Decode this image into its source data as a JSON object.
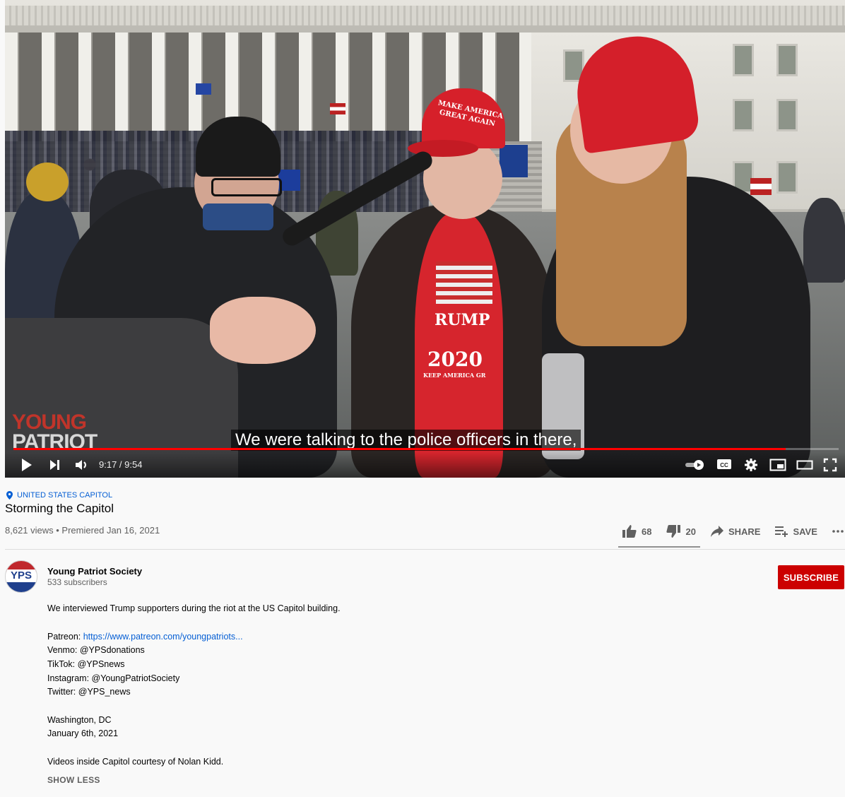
{
  "video": {
    "watermark_line1": "YOUNG",
    "watermark_line2": "PATRIOT",
    "caption": "We were talking to the police officers in there,",
    "time": "9:17 / 9:54",
    "progress": 0.936,
    "hat_text_1": "MAKE AMERICA",
    "hat_text_2": "GREAT AGAIN",
    "shirt_text_1": "RUMP",
    "shirt_text_2": "2020",
    "shirt_text_3": "KEEP AMERICA GR"
  },
  "controls": {
    "play_icon": "play-icon",
    "next_icon": "next-icon",
    "volume_icon": "volume-icon",
    "autoplay_icon": "autoplay-toggle-icon",
    "cc_label": "CC"
  },
  "meta": {
    "location": "UNITED STATES CAPITOL",
    "title": "Storming the Capitol",
    "stats": "8,621 views • Premiered Jan 16, 2021",
    "likes": "68",
    "dislikes": "20",
    "share": "SHARE",
    "save": "SAVE"
  },
  "channel": {
    "avatar_text": "YPS",
    "name": "Young Patriot Society",
    "subscribers": "533 subscribers",
    "subscribe_label": "SUBSCRIBE"
  },
  "description": {
    "line1": "We interviewed Trump supporters during the riot at the US Capitol building.",
    "patreon_label": "Patreon: ",
    "patreon_link": "https://www.patreon.com/youngpatriots...",
    "venmo": "Venmo: @YPSdonations",
    "tiktok": "TikTok: @YPSnews",
    "instagram": "Instagram: @YoungPatriotSociety",
    "twitter": "Twitter: @YPS_news",
    "place": "Washington, DC",
    "date": "January 6th, 2021",
    "credit": "Videos inside Capitol courtesy of Nolan Kidd.",
    "show_less": "SHOW LESS"
  },
  "colors": {
    "accent_red": "#cc0000",
    "link_blue": "#065fd4",
    "progress_red": "#ff0000"
  }
}
